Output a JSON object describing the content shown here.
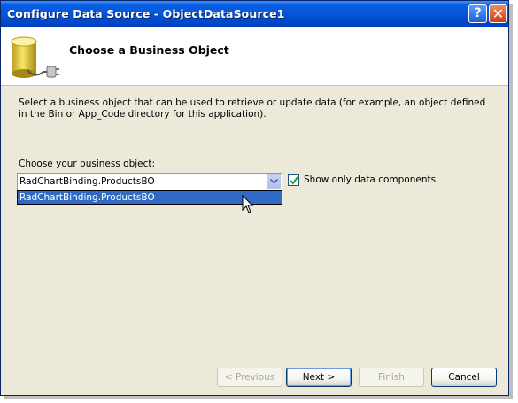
{
  "window": {
    "title": "Configure Data Source - ObjectDataSource1"
  },
  "titlebar": {
    "help_glyph": "?",
    "close_glyph": "✕"
  },
  "header": {
    "title": "Choose a Business Object",
    "icon": "database-plug-icon"
  },
  "description": "Select a business object that can be used to retrieve or update data (for example, an object defined in the Bin or App_Code directory for this application).",
  "business_object": {
    "label": "Choose your business object:",
    "selected": "RadChartBinding.ProductsBO",
    "options": [
      "RadChartBinding.ProductsBO"
    ]
  },
  "show_only_data_components": {
    "label": "Show only data components",
    "checked": true
  },
  "buttons": {
    "previous": "< Previous",
    "next": "Next >",
    "finish": "Finish",
    "cancel": "Cancel"
  }
}
